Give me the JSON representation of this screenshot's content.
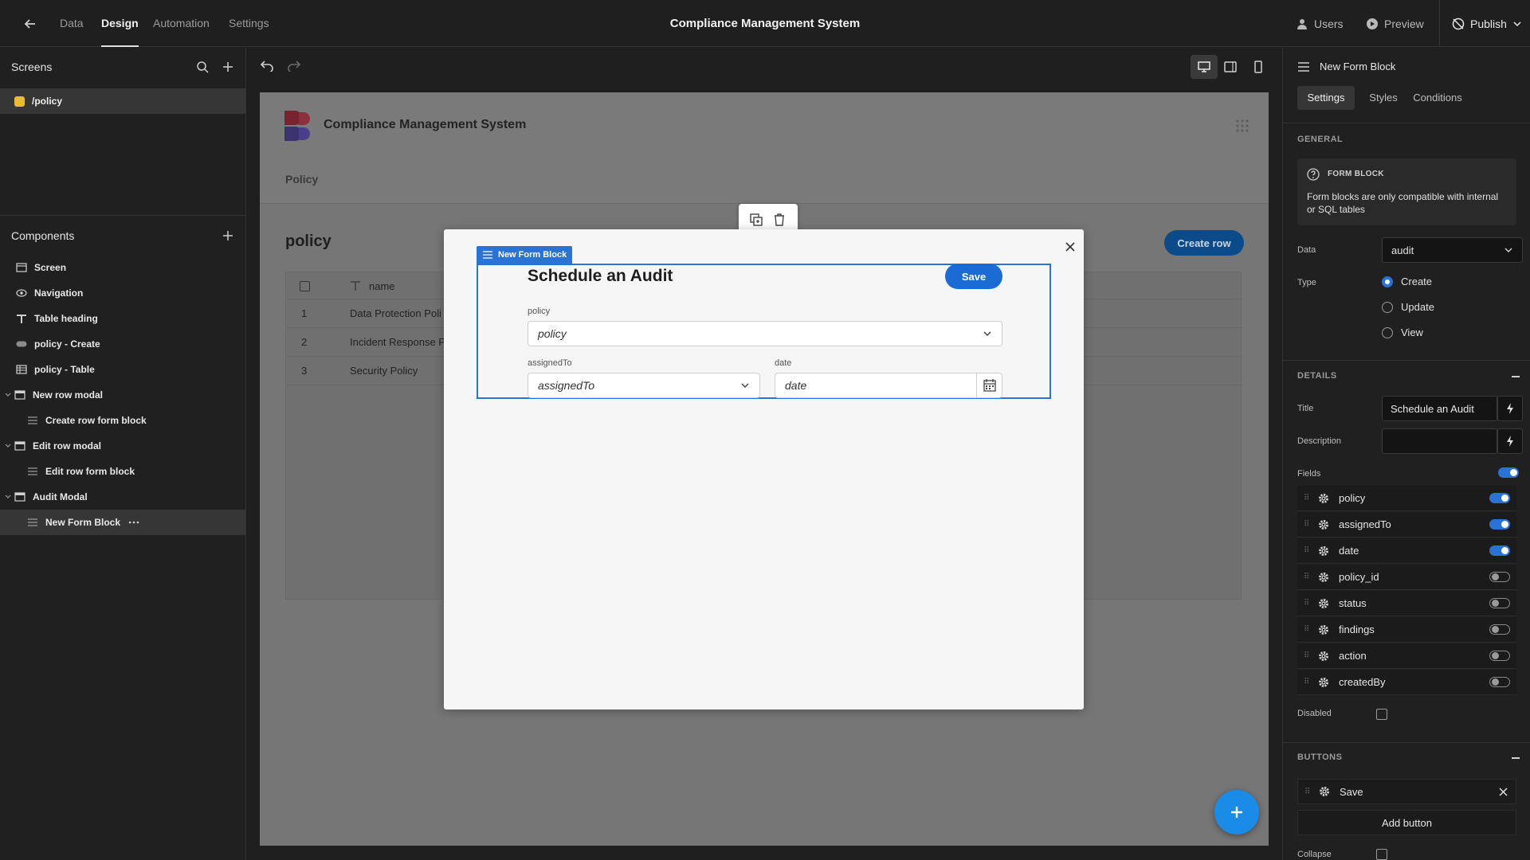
{
  "topbar": {
    "nav": [
      "Data",
      "Design",
      "Automation",
      "Settings"
    ],
    "active_nav": "Design",
    "title": "Compliance Management System",
    "users_label": "Users",
    "preview_label": "Preview",
    "publish_label": "Publish"
  },
  "screens": {
    "title": "Screens",
    "items": [
      {
        "label": "/policy",
        "color": "#e8b93a"
      }
    ]
  },
  "components": {
    "title": "Components",
    "items": [
      {
        "label": "Screen",
        "icon": "screen-icon",
        "indent": 0
      },
      {
        "label": "Navigation",
        "icon": "eye-icon",
        "indent": 0
      },
      {
        "label": "Table heading",
        "icon": "text-icon",
        "indent": 0
      },
      {
        "label": "policy - Create",
        "icon": "button-icon",
        "indent": 0
      },
      {
        "label": "policy - Table",
        "icon": "table-icon",
        "indent": 0
      },
      {
        "label": "New row modal",
        "icon": "modal-icon",
        "indent": 0,
        "expanded": true
      },
      {
        "label": "Create row form block",
        "icon": "form-icon",
        "indent": 1
      },
      {
        "label": "Edit row modal",
        "icon": "modal-icon",
        "indent": 0,
        "expanded": true
      },
      {
        "label": "Edit row form block",
        "icon": "form-icon",
        "indent": 1
      },
      {
        "label": "Audit Modal",
        "icon": "modal-icon",
        "indent": 0,
        "expanded": true
      },
      {
        "label": "New Form Block",
        "icon": "form-icon",
        "indent": 1,
        "selected": true
      }
    ]
  },
  "preview": {
    "app_name": "Compliance Management System",
    "nav_item": "Policy",
    "page_heading": "policy",
    "create_row_label": "Create row",
    "table": {
      "column": "name",
      "rows": [
        {
          "num": "1",
          "name": "Data Protection Poli"
        },
        {
          "num": "2",
          "name": "Incident Response P"
        },
        {
          "num": "3",
          "name": "Security Policy"
        }
      ]
    },
    "modal": {
      "tag_label": "New Form Block",
      "form_title": "Schedule an Audit",
      "save_label": "Save",
      "fields": {
        "policy_label": "policy",
        "policy_placeholder": "policy",
        "assigned_label": "assignedTo",
        "assigned_placeholder": "assignedTo",
        "date_label": "date",
        "date_placeholder": "date"
      }
    }
  },
  "right": {
    "header": "New Form Block",
    "tabs": [
      "Settings",
      "Styles",
      "Conditions"
    ],
    "active_tab": "Settings",
    "general_label": "GENERAL",
    "info_title": "FORM BLOCK",
    "info_text": "Form blocks are only compatible with internal or SQL tables",
    "data_label": "Data",
    "data_value": "audit",
    "type_label": "Type",
    "type_options": [
      "Create",
      "Update",
      "View"
    ],
    "type_selected": "Create",
    "details_label": "DETAILS",
    "title_label": "Title",
    "title_value": "Schedule an Audit",
    "description_label": "Description",
    "description_value": "",
    "fields_label": "Fields",
    "fields": [
      {
        "name": "policy",
        "on": true
      },
      {
        "name": "assignedTo",
        "on": true
      },
      {
        "name": "date",
        "on": true
      },
      {
        "name": "policy_id",
        "on": false
      },
      {
        "name": "status",
        "on": false
      },
      {
        "name": "findings",
        "on": false
      },
      {
        "name": "action",
        "on": false
      },
      {
        "name": "createdBy",
        "on": false
      }
    ],
    "disabled_label": "Disabled",
    "buttons_label": "BUTTONS",
    "buttons": [
      {
        "name": "Save"
      }
    ],
    "add_button_label": "Add button",
    "collapse_label": "Collapse"
  },
  "colors": {
    "accent": "#2a73d6",
    "create_row_button": "#0b4b8a",
    "fab": "#1b8be8"
  }
}
